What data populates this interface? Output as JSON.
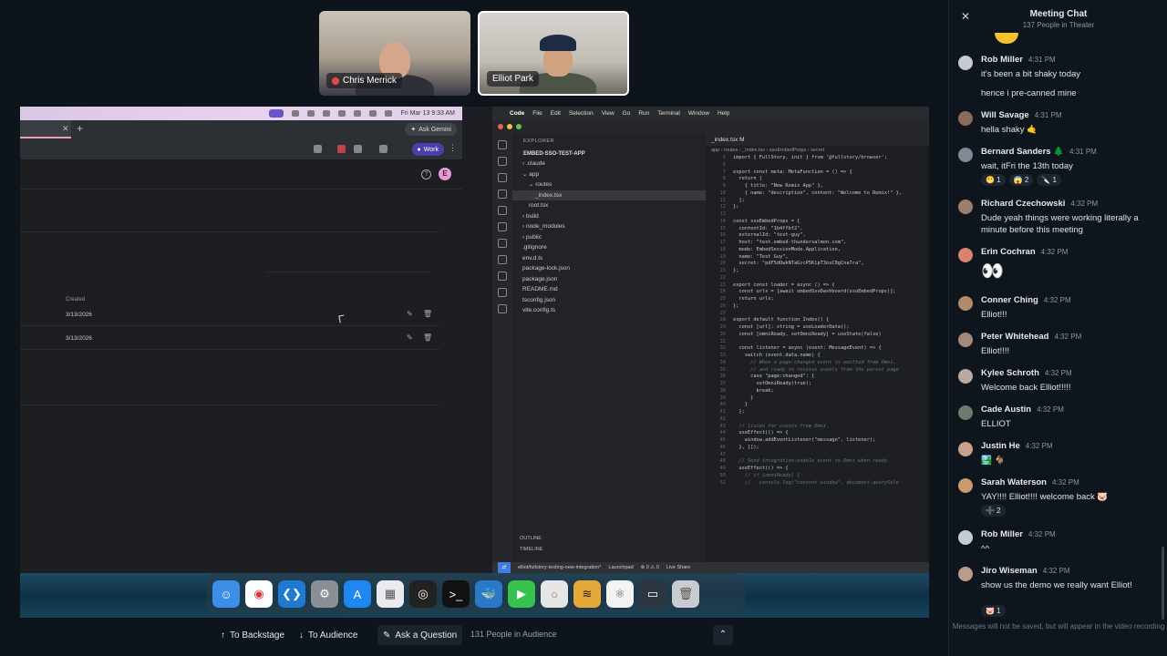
{
  "participants": [
    {
      "name": "Chris Merrick",
      "muted": true
    },
    {
      "name": "Elliot Park",
      "muted": false
    }
  ],
  "screen": {
    "menubar_clock": "Fri Mar 13  9:33 AM",
    "browser": {
      "ask_gemini": "Ask Gemini",
      "work_profile": "Work",
      "avatar_letter": "E",
      "col_created": "Created",
      "rows": [
        {
          "date": "3/13/2026"
        },
        {
          "date": "3/13/2026"
        }
      ]
    },
    "vscode": {
      "menu": [
        "Code",
        "File",
        "Edit",
        "Selection",
        "View",
        "Go",
        "Run",
        "Terminal",
        "Window",
        "Help"
      ],
      "explorer_title": "EXPLORER",
      "project": "EMBED-SSO-TEST-APP",
      "files": [
        {
          "label": "› .claude",
          "indent": 1,
          "sel": false
        },
        {
          "label": "⌄ app",
          "indent": 1,
          "sel": false
        },
        {
          "label": "⌄ routes",
          "indent": 2,
          "sel": false
        },
        {
          "label": "_index.tsx",
          "indent": 3,
          "sel": true
        },
        {
          "label": "root.tsx",
          "indent": 2,
          "sel": false
        },
        {
          "label": "› build",
          "indent": 1,
          "sel": false
        },
        {
          "label": "› node_modules",
          "indent": 1,
          "sel": false
        },
        {
          "label": "› public",
          "indent": 1,
          "sel": false
        },
        {
          "label": ".gitignore",
          "indent": 1,
          "sel": false
        },
        {
          "label": "env.d.ts",
          "indent": 1,
          "sel": false
        },
        {
          "label": "package-lock.json",
          "indent": 1,
          "sel": false
        },
        {
          "label": "package.json",
          "indent": 1,
          "sel": false
        },
        {
          "label": "README.md",
          "indent": 1,
          "sel": false
        },
        {
          "label": "tsconfig.json",
          "indent": 1,
          "sel": false
        },
        {
          "label": "vite.config.ts",
          "indent": 1,
          "sel": false
        }
      ],
      "outline": "OUTLINE",
      "timeline": "TIMELINE",
      "tab": "_index.tsx  M",
      "breadcrumb": "app › routes › _index.tsx › ssoEmbedProps › secret",
      "code": [
        {
          "n": "5",
          "t": "import { FullStory, init } from '@fullstory/browser';"
        },
        {
          "n": "6",
          "t": ""
        },
        {
          "n": "7",
          "t": "export const meta: MetaFunction = () => {"
        },
        {
          "n": "8",
          "t": "  return ["
        },
        {
          "n": "9",
          "t": "    { title: \"New Remix App\" },"
        },
        {
          "n": "10",
          "t": "    { name: \"description\", content: \"Welcome to Remix!\" },"
        },
        {
          "n": "11",
          "t": "  ];"
        },
        {
          "n": "12",
          "t": "};"
        },
        {
          "n": "13",
          "t": ""
        },
        {
          "n": "14",
          "t": "const ssoEmbedProps = {"
        },
        {
          "n": "15",
          "t": "  contentId: \"1b4ffbf2\","
        },
        {
          "n": "16",
          "t": "  externalId: \"test-guy\","
        },
        {
          "n": "17",
          "t": "  host: \"test.embed-thundersalmon.com\","
        },
        {
          "n": "18",
          "t": "  mode: EmbedSessionMode.Application,"
        },
        {
          "n": "19",
          "t": "  name: \"Test Guy\","
        },
        {
          "n": "20",
          "t": "  secret: \"pdF5dOwkNTaGccP5KipT3osC0gCna7ra\","
        },
        {
          "n": "21",
          "t": "};"
        },
        {
          "n": "22",
          "t": ""
        },
        {
          "n": "23",
          "t": "export const loader = async () => {"
        },
        {
          "n": "24",
          "t": "  const urls = [await embedSsoDashboard(ssoEmbedProps)];"
        },
        {
          "n": "25",
          "t": "  return urls;"
        },
        {
          "n": "26",
          "t": "};"
        },
        {
          "n": "27",
          "t": ""
        },
        {
          "n": "28",
          "t": "export default function Index() {"
        },
        {
          "n": "29",
          "t": "  const [url]: string = useLoaderData();"
        },
        {
          "n": "30",
          "t": "  const [omniReady, setOmniReady] = useState(false)"
        },
        {
          "n": "31",
          "t": ""
        },
        {
          "n": "32",
          "t": "  const listener = async (event: MessageEvent) => {"
        },
        {
          "n": "33",
          "t": "    switch (event.data.name) {"
        },
        {
          "n": "34",
          "t": "      // When a page:changed event is emitted from Omni,"
        },
        {
          "n": "35",
          "t": "      // and ready to receive events from the parent page"
        },
        {
          "n": "36",
          "t": "      case \"page:changed\": {"
        },
        {
          "n": "37",
          "t": "        setOmniReady(true);"
        },
        {
          "n": "38",
          "t": "        break;"
        },
        {
          "n": "39",
          "t": "      }"
        },
        {
          "n": "40",
          "t": "    }"
        },
        {
          "n": "41",
          "t": "  };"
        },
        {
          "n": "42",
          "t": ""
        },
        {
          "n": "43",
          "t": "  // listen for events from Omni."
        },
        {
          "n": "44",
          "t": "  useEffect(() => {"
        },
        {
          "n": "45",
          "t": "    window.addEventListener(\"message\", listener);"
        },
        {
          "n": "46",
          "t": "  }, []);"
        },
        {
          "n": "47",
          "t": ""
        },
        {
          "n": "48",
          "t": "  // Send integration:enable event to Omni when ready."
        },
        {
          "n": "49",
          "t": "  useEffect(() => {"
        },
        {
          "n": "50",
          "t": "    // if (omniReady) {"
        },
        {
          "n": "51",
          "t": "    //   console.log(\"content window\", document.querySele"
        }
      ],
      "status": {
        "branch": "elliot/fullstory-testing-new-integration*",
        "launchpad": "Launchpad",
        "problems": "⊗ 0  ⚠ 0",
        "liveshare": "Live Share"
      }
    }
  },
  "controls": {
    "backstage": "To Backstage",
    "audience": "To Audience",
    "ask": "Ask a Question",
    "audience_count": "131 People in Audience"
  },
  "chat": {
    "title": "Meeting Chat",
    "subtitle": "137 People in Theater",
    "messages": [
      {
        "name": "Rob Miller",
        "time": "4:31 PM",
        "lines": [
          "it's been a bit shaky today",
          "",
          "hence i pre-canned mine"
        ],
        "avatar_color": "#c7ccd3",
        "reactions": []
      },
      {
        "name": "Will Savage",
        "time": "4:31 PM",
        "lines": [
          "hella shaky 🤙"
        ],
        "avatar_color": "#8a6a5a",
        "reactions": []
      },
      {
        "name": "Bernard Sanders 🌲",
        "time": "4:31 PM",
        "lines": [
          "wait, itFri the 13th today"
        ],
        "avatar_color": "#7e8a96",
        "reactions": [
          "😬 1",
          "😱 2",
          "🔪 1"
        ]
      },
      {
        "name": "Richard Czechowski",
        "time": "4:32 PM",
        "lines": [
          "Dude yeah things were working literally a minute before this meeting"
        ],
        "avatar_color": "#9a7f6b",
        "reactions": []
      },
      {
        "name": "Erin Cochran",
        "time": "4:32 PM",
        "lines": [
          "👀"
        ],
        "avatar_color": "#d9826e",
        "reactions": []
      },
      {
        "name": "Conner Ching",
        "time": "4:32 PM",
        "lines": [
          "Elliot!!!"
        ],
        "avatar_color": "#b08d6a",
        "reactions": []
      },
      {
        "name": "Peter Whitehead",
        "time": "4:32 PM",
        "lines": [
          "Elliot!!!!"
        ],
        "avatar_color": "#a28a7a",
        "reactions": []
      },
      {
        "name": "Kylee Schroth",
        "time": "4:32 PM",
        "lines": [
          "Welcome back Elliot!!!!!"
        ],
        "avatar_color": "#b9a9a0",
        "reactions": []
      },
      {
        "name": "Cade Austin",
        "time": "4:32 PM",
        "lines": [
          "ELLIOT"
        ],
        "avatar_color": "#6f7a6a",
        "reactions": []
      },
      {
        "name": "Justin He",
        "time": "4:32 PM",
        "lines": [
          "🏞️ 🐐"
        ],
        "avatar_color": "#c9a08b",
        "reactions": []
      },
      {
        "name": "Sarah Waterson",
        "time": "4:32 PM",
        "lines": [
          "YAY!!!! Elliot!!!! welcome back 🐷"
        ],
        "avatar_color": "#c99b6e",
        "reactions": [
          "➕ 2"
        ]
      },
      {
        "name": "Rob Miller",
        "time": "4:32 PM",
        "lines": [
          "^^"
        ],
        "avatar_color": "#c7ccd3",
        "reactions": []
      },
      {
        "name": "Jiro Wiseman",
        "time": "4:32 PM",
        "lines": [
          "show us the demo we really want Elliot!"
        ],
        "avatar_color": "#b89c8c",
        "reactions": [
          "🐷 1"
        ]
      }
    ],
    "footer": "Messages will not be saved, but will appear in the video recording"
  },
  "colors": {
    "accent": "#4a3fa8",
    "bg": "#0e141b",
    "chat_bg": "#0f151c"
  }
}
